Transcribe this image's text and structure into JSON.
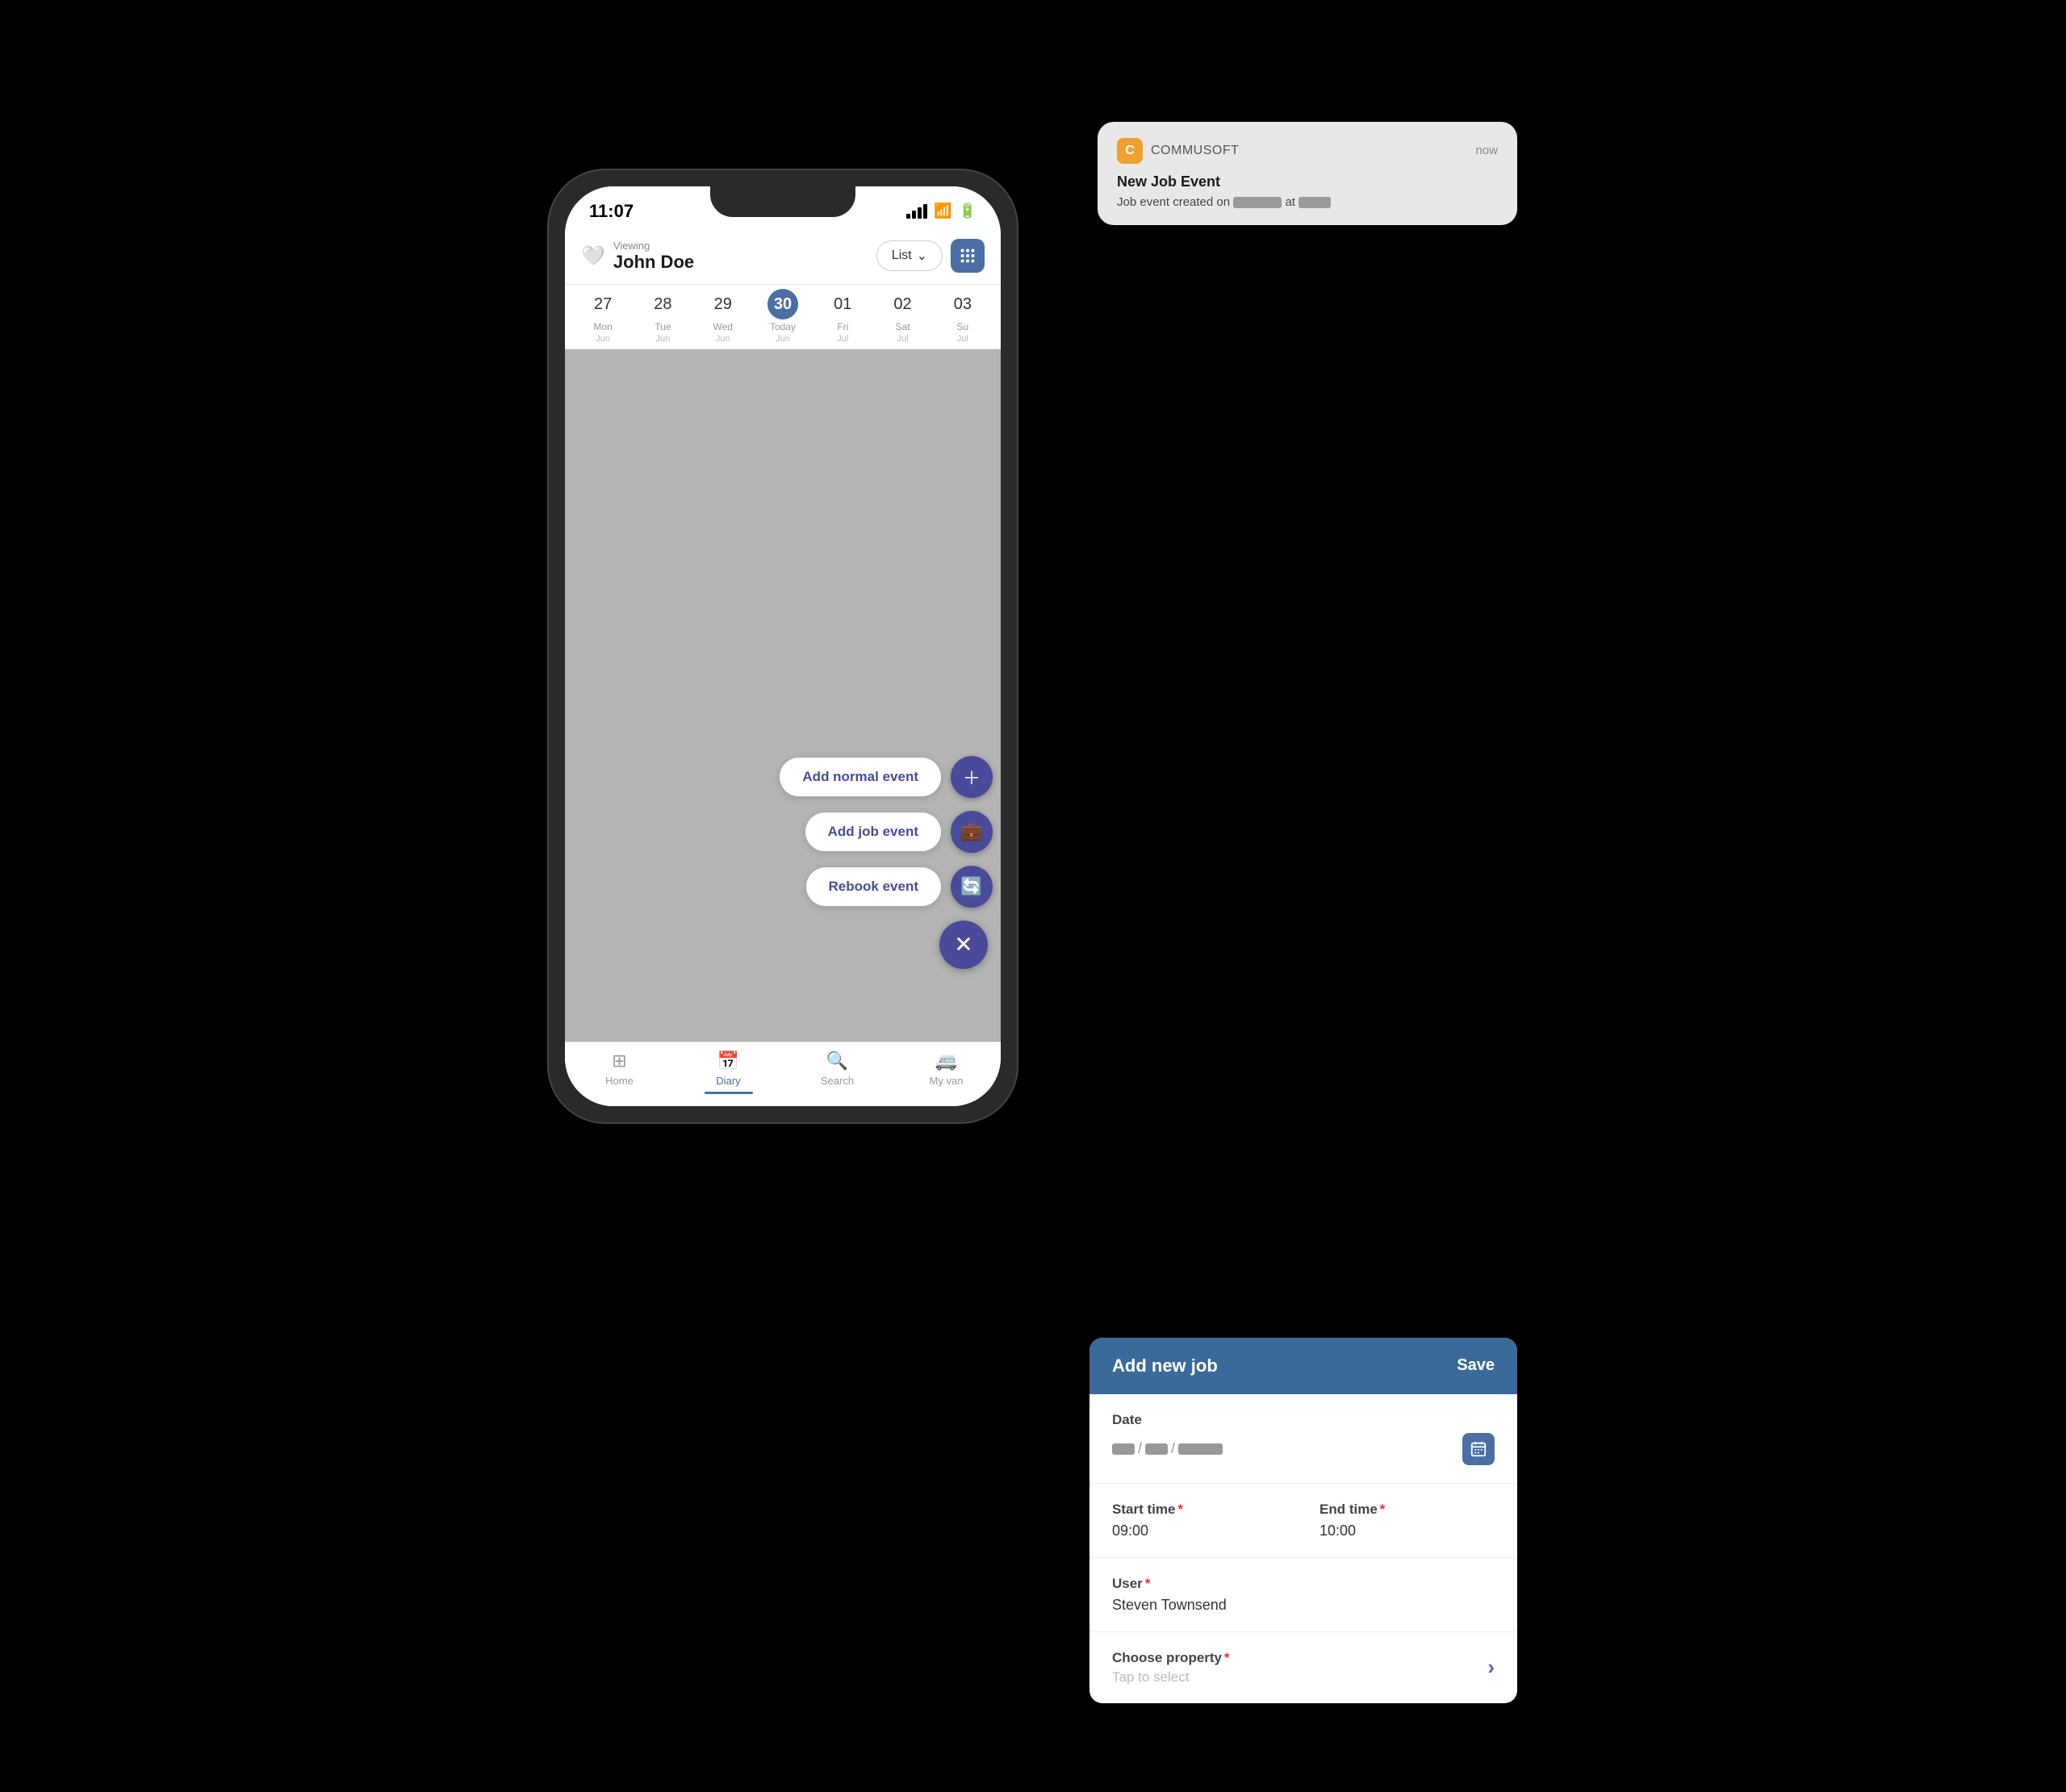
{
  "phone": {
    "status": {
      "time": "11:07"
    },
    "header": {
      "viewing_label": "Viewing",
      "user_name": "John Doe",
      "list_btn": "List",
      "grid_icon": "grid-icon"
    },
    "calendar": {
      "days": [
        {
          "num": "27",
          "label": "Mon",
          "month": "Jun",
          "today": false
        },
        {
          "num": "28",
          "label": "Tue",
          "month": "Jun",
          "today": false
        },
        {
          "num": "29",
          "label": "Wed",
          "month": "Jun",
          "today": false
        },
        {
          "num": "30",
          "label": "Today",
          "month": "Jun",
          "today": true
        },
        {
          "num": "01",
          "label": "Fri",
          "month": "Jul",
          "today": false
        },
        {
          "num": "02",
          "label": "Sat",
          "month": "Jul",
          "today": false
        },
        {
          "num": "03",
          "label": "Su",
          "month": "Jul",
          "today": false
        }
      ]
    },
    "fab": {
      "add_normal": "Add normal event",
      "add_job": "Add job event",
      "rebook": "Rebook event"
    },
    "nav": {
      "home": "Home",
      "diary": "Diary",
      "search": "Search",
      "my_van": "My van"
    }
  },
  "notification": {
    "app_name": "COMMUSOFT",
    "time": "now",
    "title": "New Job Event",
    "body": "Job event created on",
    "at_text": "at",
    "logo_letter": "C"
  },
  "modal": {
    "title": "Add new job",
    "save_label": "Save",
    "date_label": "Date",
    "start_time_label": "Start time",
    "start_time_value": "09:00",
    "end_time_label": "End time",
    "end_time_value": "10:00",
    "user_label": "User",
    "user_value": "Steven Townsend",
    "property_label": "Choose property",
    "property_placeholder": "Tap to select"
  },
  "colors": {
    "accent": "#3a6a9a",
    "purple": "#4a4a9a",
    "required_red": "#e53030"
  }
}
